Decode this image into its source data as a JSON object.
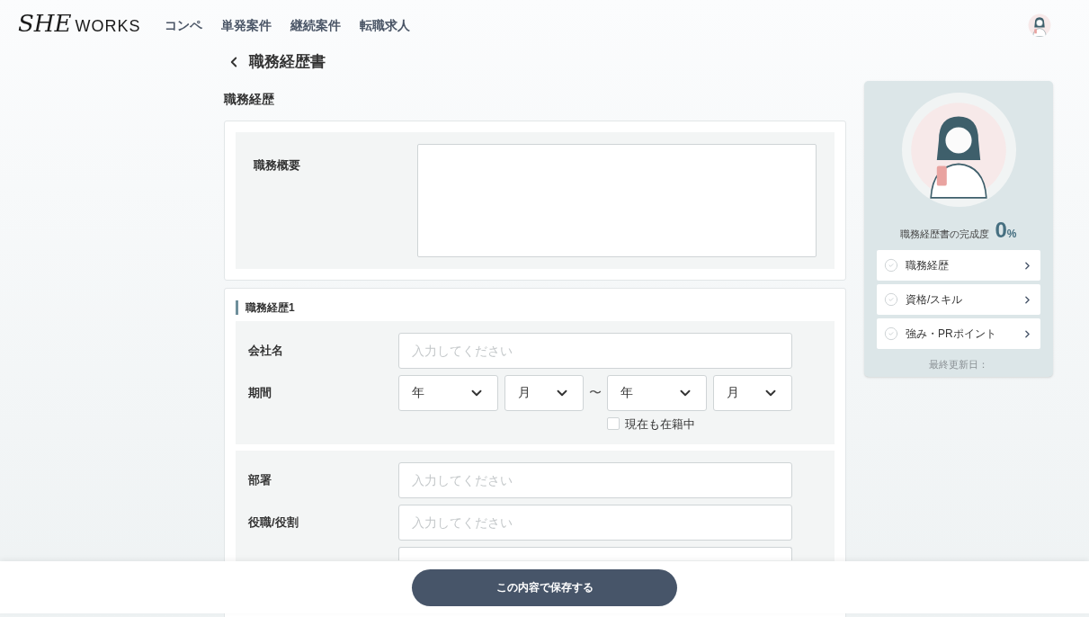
{
  "header": {
    "logo_script": "SHE",
    "logo_word": "WORKS",
    "nav": [
      "コンペ",
      "単発案件",
      "継続案件",
      "転職求人"
    ]
  },
  "page": {
    "title": "職務経歴書",
    "section_heading": "職務経歴"
  },
  "summary": {
    "label": "職務概要"
  },
  "career": {
    "title": "職務経歴1",
    "groups": [
      [
        {
          "kind": "text",
          "label": "会社名",
          "placeholder": "入力してください"
        },
        {
          "kind": "period",
          "label": "期間",
          "selects": [
            "年",
            "月",
            "年",
            "月"
          ],
          "separator": "〜",
          "current": {
            "label": "現在も在籍中",
            "checked": false
          }
        }
      ],
      [
        {
          "kind": "text",
          "label": "部署",
          "placeholder": "入力してください"
        },
        {
          "kind": "text",
          "label": "役職/役割",
          "placeholder": "入力してください"
        },
        {
          "kind": "blank"
        }
      ]
    ]
  },
  "sidebar": {
    "completion_label": "職務経歴書の完成度",
    "percent": "0",
    "percent_unit": "%",
    "items": [
      {
        "label": "職務経歴",
        "done": false
      },
      {
        "label": "資格/スキル",
        "done": false
      },
      {
        "label": "強み・PRポイント",
        "done": false
      }
    ],
    "last_updated": "最終更新日："
  },
  "footer": {
    "save_button": "この内容で保存する"
  }
}
